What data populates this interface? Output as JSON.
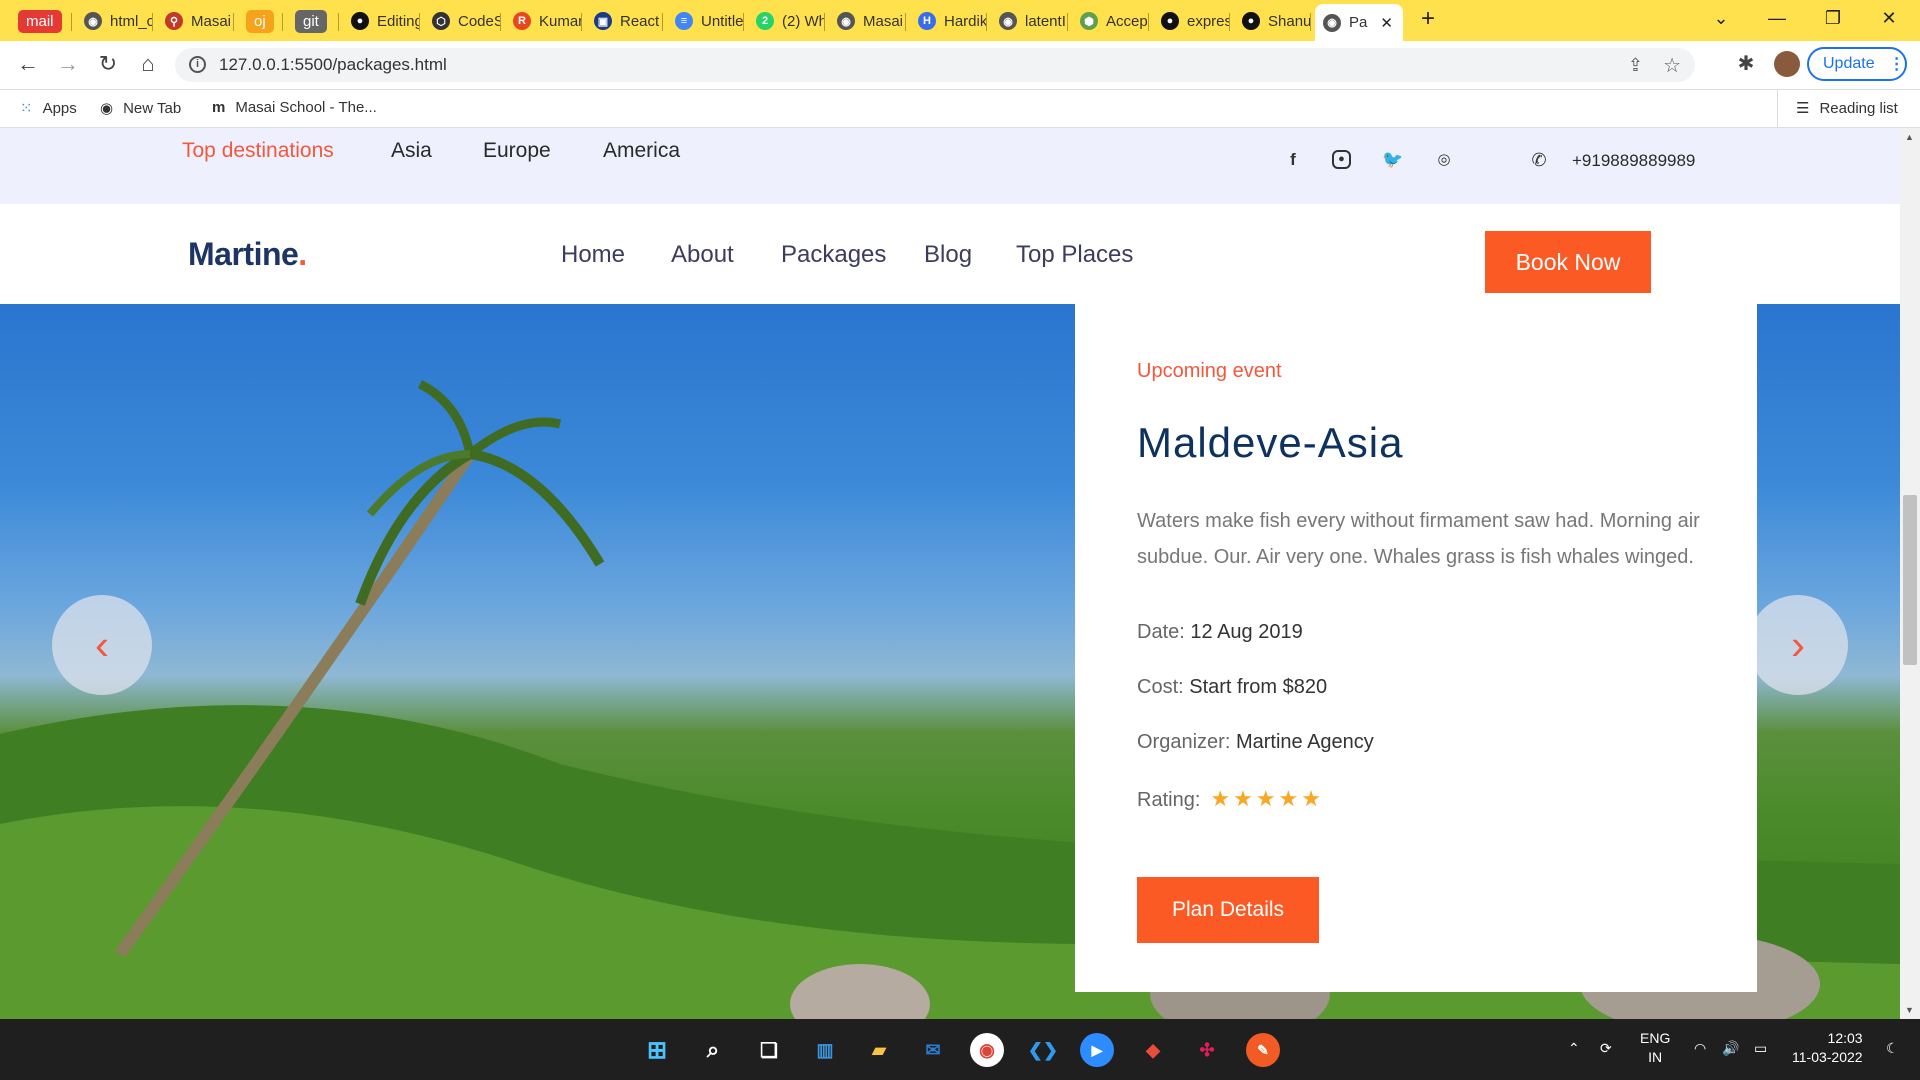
{
  "browser": {
    "tabs": [
      {
        "label": "mail",
        "type": "pill",
        "color": "#e53935"
      },
      {
        "label": "html_c",
        "icon": "globe-icon"
      },
      {
        "label": "Masai",
        "icon": "pin-icon"
      },
      {
        "label": "oj",
        "type": "pill",
        "color": "#f7a21b"
      },
      {
        "label": "git",
        "type": "pill",
        "color": "#666666"
      },
      {
        "label": "Editing",
        "icon": "github-icon"
      },
      {
        "label": "CodeS",
        "icon": "cube-icon"
      },
      {
        "label": "Kumar",
        "icon": "r-icon"
      },
      {
        "label": "React",
        "icon": "save-icon"
      },
      {
        "label": "Untitle",
        "icon": "doc-icon"
      },
      {
        "label": "(2) Wh",
        "icon": "whatsapp-icon"
      },
      {
        "label": "Masai",
        "icon": "globe-icon"
      },
      {
        "label": "Hardik",
        "icon": "h-icon"
      },
      {
        "label": "latentI",
        "icon": "globe-icon"
      },
      {
        "label": "Accep",
        "icon": "node-icon"
      },
      {
        "label": "expres",
        "icon": "github-icon"
      },
      {
        "label": "Shanu",
        "icon": "github-icon"
      },
      {
        "label": "Pa",
        "icon": "globe-icon",
        "active": true
      }
    ],
    "new_tab": "+",
    "url": "127.0.0.1:5500/packages.html",
    "update_label": "Update",
    "bookmarks": [
      {
        "label": "Apps",
        "icon": "apps-grid-icon"
      },
      {
        "label": "New Tab",
        "icon": "globe-icon"
      },
      {
        "label": "Masai School - The...",
        "icon": "m-icon"
      }
    ],
    "reading_list": "Reading list"
  },
  "site": {
    "top_links": [
      "Top destinations",
      "Asia",
      "Europe",
      "America"
    ],
    "phone": "+919889889989",
    "logo": "Martine",
    "logo_dot": ".",
    "nav": [
      "Home",
      "About",
      "Packages",
      "Blog",
      "Top Places"
    ],
    "book_now": "Book Now",
    "event": {
      "kicker": "Upcoming event",
      "title": "Maldeve-Asia",
      "description": "Waters make fish every without firmament saw had. Morning air subdue. Our. Air very one. Whales grass is fish whales winged.",
      "date_label": "Date:",
      "date_value": "12 Aug 2019",
      "cost_label": "Cost:",
      "cost_value": "Start from $820",
      "organizer_label": "Organizer:",
      "organizer_value": "Martine Agency",
      "rating_label": "Rating:",
      "rating_stars": 5,
      "stars": "★★★★★",
      "plan_button": "Plan Details"
    },
    "prev_arrow": "‹",
    "next_arrow": "›",
    "accent": "#fc5a24"
  },
  "taskbar": {
    "lang": "ENG",
    "region": "IN",
    "time": "12:03",
    "date": "11-03-2022"
  }
}
